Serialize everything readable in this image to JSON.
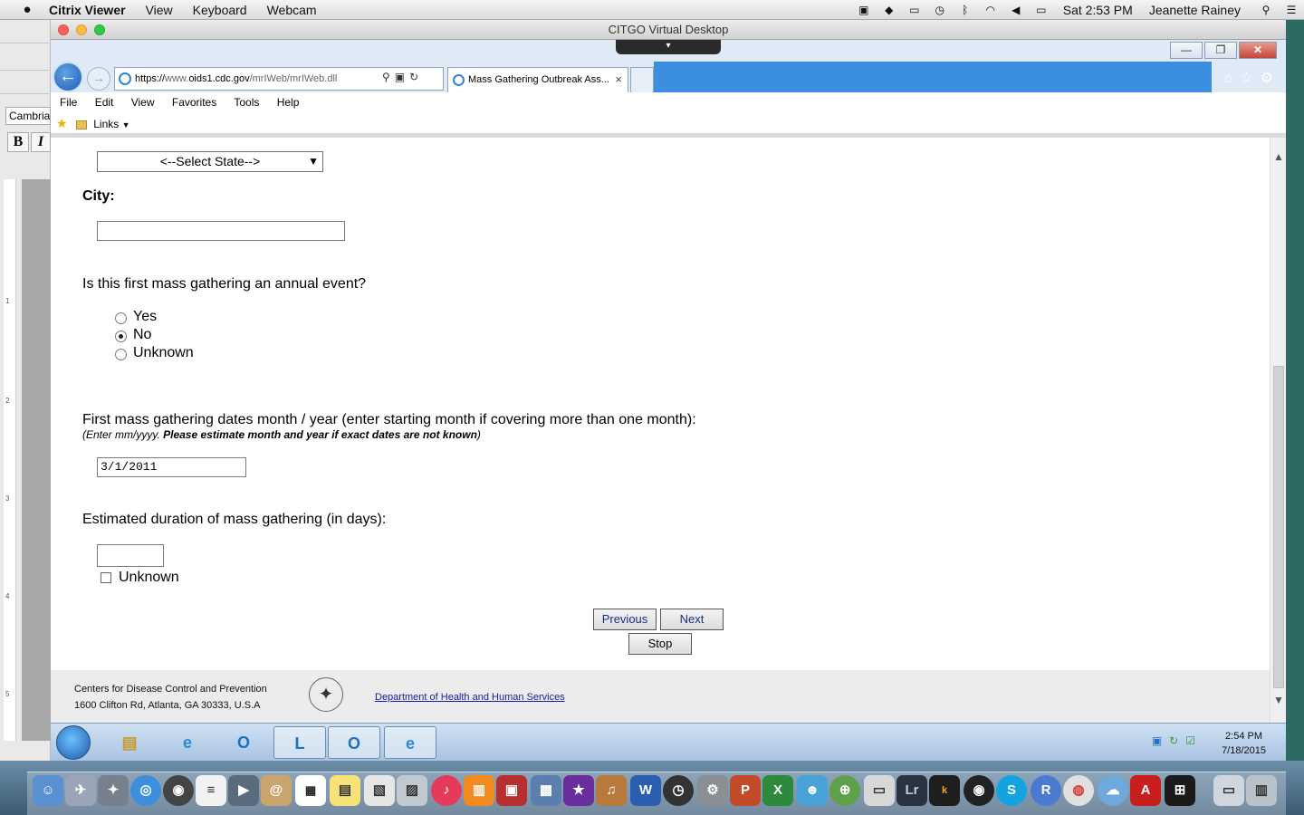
{
  "mac_menubar": {
    "app_name": "Citrix Viewer",
    "menus": [
      "View",
      "Keyboard",
      "Webcam"
    ],
    "clock": "Sat 2:53 PM",
    "user": "Jeanette Rainey"
  },
  "word": {
    "font_name": "Cambria",
    "bold": "B",
    "italic": "I",
    "ruler_marks": [
      "1",
      "2",
      "3",
      "4",
      "5"
    ]
  },
  "citrix": {
    "title": "CITGO Virtual Desktop"
  },
  "browser": {
    "url_prefix": "https://",
    "url_host_gray": "www.",
    "url_host": "oids1.cdc.gov",
    "url_path": "/mrIWeb/mrIWeb.dll",
    "tab_title": "Mass Gathering Outbreak Ass...",
    "menu": [
      "File",
      "Edit",
      "View",
      "Favorites",
      "Tools",
      "Help"
    ],
    "favorites_links": "Links"
  },
  "form": {
    "state_select": "<--Select State-->",
    "city_label": "City:",
    "city_value": "",
    "annual_question": "Is this first mass gathering an annual event?",
    "annual_options": [
      "Yes",
      "No",
      "Unknown"
    ],
    "annual_selected": "No",
    "dates_question": "First mass gathering dates month / year (enter starting month if covering more than one month):",
    "dates_hint_italic": "(Enter mm/yyyy.",
    "dates_hint_bold": "Please estimate month and year if exact dates are not known",
    "dates_hint_end": ")",
    "dates_value": "3/1/2011",
    "duration_question": "Estimated duration of mass gathering (in days):",
    "duration_value": "",
    "duration_unknown": "Unknown",
    "buttons": {
      "previous": "Previous",
      "next": "Next",
      "stop": "Stop"
    }
  },
  "footer": {
    "org_line1": "Centers for Disease Control and Prevention",
    "org_line2": "1600 Clifton Rd, Atlanta, GA 30333, U.S.A",
    "hhs_link": "Department of Health and Human Services"
  },
  "windows_taskbar": {
    "time": "2:54 PM",
    "date": "7/18/2015"
  }
}
